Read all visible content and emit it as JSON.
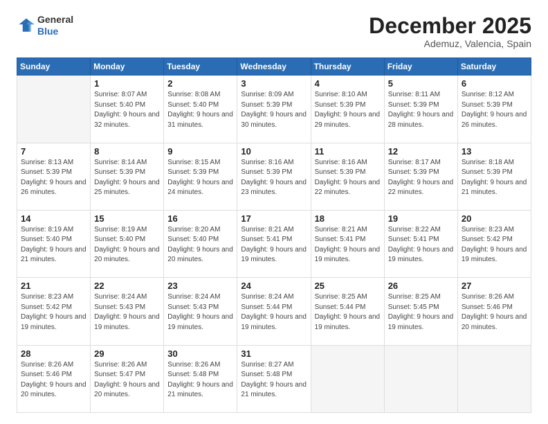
{
  "header": {
    "logo": {
      "line1": "General",
      "line2": "Blue"
    },
    "month": "December 2025",
    "location": "Ademuz, Valencia, Spain"
  },
  "weekdays": [
    "Sunday",
    "Monday",
    "Tuesday",
    "Wednesday",
    "Thursday",
    "Friday",
    "Saturday"
  ],
  "weeks": [
    [
      {
        "day": "",
        "empty": true
      },
      {
        "day": "1",
        "sunrise": "8:07 AM",
        "sunset": "5:40 PM",
        "daylight": "9 hours and 32 minutes."
      },
      {
        "day": "2",
        "sunrise": "8:08 AM",
        "sunset": "5:40 PM",
        "daylight": "9 hours and 31 minutes."
      },
      {
        "day": "3",
        "sunrise": "8:09 AM",
        "sunset": "5:39 PM",
        "daylight": "9 hours and 30 minutes."
      },
      {
        "day": "4",
        "sunrise": "8:10 AM",
        "sunset": "5:39 PM",
        "daylight": "9 hours and 29 minutes."
      },
      {
        "day": "5",
        "sunrise": "8:11 AM",
        "sunset": "5:39 PM",
        "daylight": "9 hours and 28 minutes."
      },
      {
        "day": "6",
        "sunrise": "8:12 AM",
        "sunset": "5:39 PM",
        "daylight": "9 hours and 26 minutes."
      }
    ],
    [
      {
        "day": "7",
        "sunrise": "8:13 AM",
        "sunset": "5:39 PM",
        "daylight": "9 hours and 26 minutes."
      },
      {
        "day": "8",
        "sunrise": "8:14 AM",
        "sunset": "5:39 PM",
        "daylight": "9 hours and 25 minutes."
      },
      {
        "day": "9",
        "sunrise": "8:15 AM",
        "sunset": "5:39 PM",
        "daylight": "9 hours and 24 minutes."
      },
      {
        "day": "10",
        "sunrise": "8:16 AM",
        "sunset": "5:39 PM",
        "daylight": "9 hours and 23 minutes."
      },
      {
        "day": "11",
        "sunrise": "8:16 AM",
        "sunset": "5:39 PM",
        "daylight": "9 hours and 22 minutes."
      },
      {
        "day": "12",
        "sunrise": "8:17 AM",
        "sunset": "5:39 PM",
        "daylight": "9 hours and 22 minutes."
      },
      {
        "day": "13",
        "sunrise": "8:18 AM",
        "sunset": "5:39 PM",
        "daylight": "9 hours and 21 minutes."
      }
    ],
    [
      {
        "day": "14",
        "sunrise": "8:19 AM",
        "sunset": "5:40 PM",
        "daylight": "9 hours and 21 minutes."
      },
      {
        "day": "15",
        "sunrise": "8:19 AM",
        "sunset": "5:40 PM",
        "daylight": "9 hours and 20 minutes."
      },
      {
        "day": "16",
        "sunrise": "8:20 AM",
        "sunset": "5:40 PM",
        "daylight": "9 hours and 20 minutes."
      },
      {
        "day": "17",
        "sunrise": "8:21 AM",
        "sunset": "5:41 PM",
        "daylight": "9 hours and 19 minutes."
      },
      {
        "day": "18",
        "sunrise": "8:21 AM",
        "sunset": "5:41 PM",
        "daylight": "9 hours and 19 minutes."
      },
      {
        "day": "19",
        "sunrise": "8:22 AM",
        "sunset": "5:41 PM",
        "daylight": "9 hours and 19 minutes."
      },
      {
        "day": "20",
        "sunrise": "8:23 AM",
        "sunset": "5:42 PM",
        "daylight": "9 hours and 19 minutes."
      }
    ],
    [
      {
        "day": "21",
        "sunrise": "8:23 AM",
        "sunset": "5:42 PM",
        "daylight": "9 hours and 19 minutes."
      },
      {
        "day": "22",
        "sunrise": "8:24 AM",
        "sunset": "5:43 PM",
        "daylight": "9 hours and 19 minutes."
      },
      {
        "day": "23",
        "sunrise": "8:24 AM",
        "sunset": "5:43 PM",
        "daylight": "9 hours and 19 minutes."
      },
      {
        "day": "24",
        "sunrise": "8:24 AM",
        "sunset": "5:44 PM",
        "daylight": "9 hours and 19 minutes."
      },
      {
        "day": "25",
        "sunrise": "8:25 AM",
        "sunset": "5:44 PM",
        "daylight": "9 hours and 19 minutes."
      },
      {
        "day": "26",
        "sunrise": "8:25 AM",
        "sunset": "5:45 PM",
        "daylight": "9 hours and 19 minutes."
      },
      {
        "day": "27",
        "sunrise": "8:26 AM",
        "sunset": "5:46 PM",
        "daylight": "9 hours and 20 minutes."
      }
    ],
    [
      {
        "day": "28",
        "sunrise": "8:26 AM",
        "sunset": "5:46 PM",
        "daylight": "9 hours and 20 minutes."
      },
      {
        "day": "29",
        "sunrise": "8:26 AM",
        "sunset": "5:47 PM",
        "daylight": "9 hours and 20 minutes."
      },
      {
        "day": "30",
        "sunrise": "8:26 AM",
        "sunset": "5:48 PM",
        "daylight": "9 hours and 21 minutes."
      },
      {
        "day": "31",
        "sunrise": "8:27 AM",
        "sunset": "5:48 PM",
        "daylight": "9 hours and 21 minutes."
      },
      {
        "day": "",
        "empty": true
      },
      {
        "day": "",
        "empty": true
      },
      {
        "day": "",
        "empty": true
      }
    ]
  ]
}
